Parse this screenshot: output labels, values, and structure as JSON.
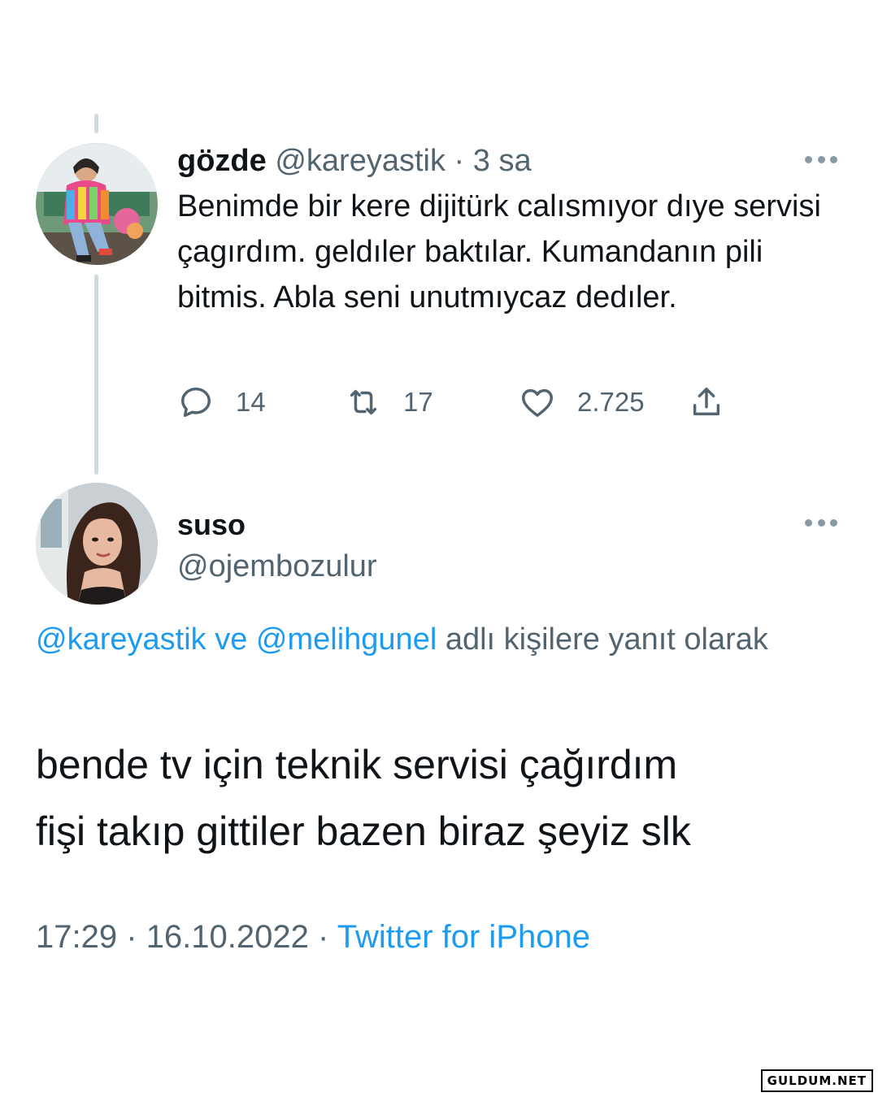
{
  "tweet1": {
    "display_name": "gözde",
    "handle": "@kareyastik",
    "separator": "·",
    "time_ago": "3 sa",
    "body": "Benimde bir kere dijitürk calısmıyor dıye servisi çagırdım. geldıler baktılar. Kumandanın pili bitmis. Abla seni unutmıycaz dedıler.",
    "actions": {
      "replies": "14",
      "retweets": "17",
      "likes": "2.725"
    }
  },
  "tweet2": {
    "display_name": "suso",
    "handle": "@ojembozulur",
    "reply_to": {
      "mention1": "@kareyastik",
      "conjunction": "ve",
      "mention2": "@melihgunel",
      "suffix": "adlı kişilere yanıt olarak"
    },
    "body_line1": "bende tv için teknik servisi çağırdım",
    "body_line2": "fişi takıp gittiler bazen biraz şeyiz slk",
    "time": "17:29",
    "date": "16.10.2022",
    "separator": "·",
    "source": "Twitter for iPhone"
  },
  "icons": {
    "reply": "reply-icon",
    "retweet": "retweet-icon",
    "like": "heart-icon",
    "share": "share-icon",
    "more": "more-dots-icon"
  },
  "colors": {
    "text": "#0f1419",
    "secondary": "#536471",
    "link": "#1d9bf0",
    "thread_line": "#cfd9de"
  },
  "watermark": "GULDUM.NET"
}
